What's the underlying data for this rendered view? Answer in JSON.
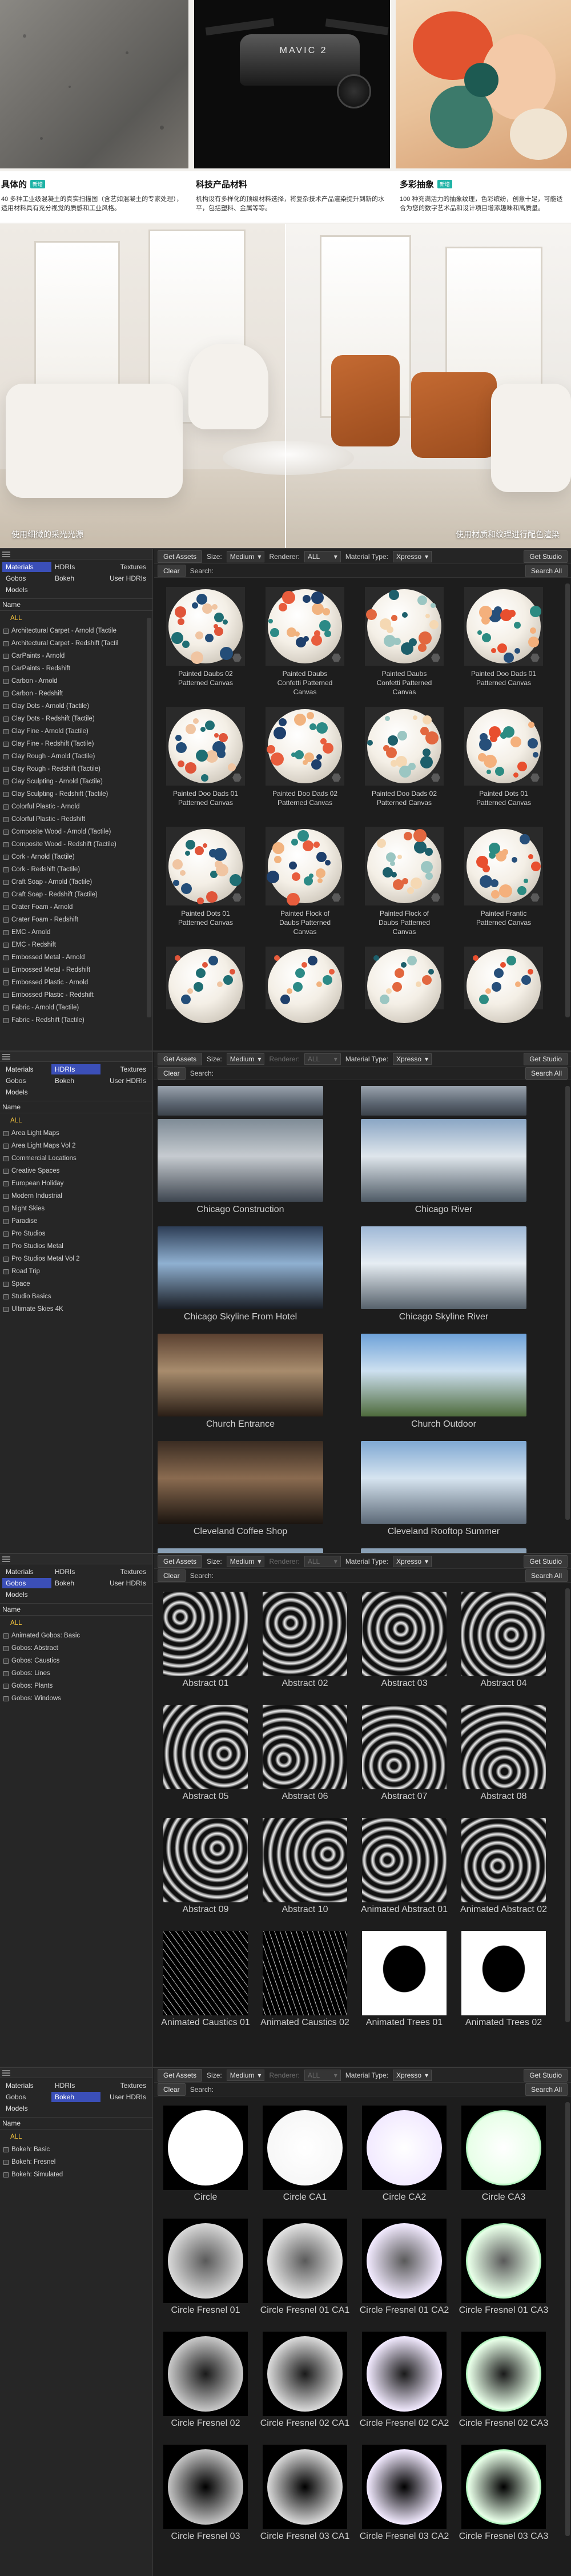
{
  "hero": {
    "thumb2_label": "MAVIC 2",
    "captions": [
      {
        "title": "具体的",
        "tag": "新增",
        "text": "40 多种工业级混凝土的真实扫描图（含艺如混凝土的专家处理），适用材料具有充分视觉的质感和工业风格。"
      },
      {
        "title": "科技产品材料",
        "tag": "",
        "text": "机构设有多样化的顶级材料选择，将复杂技术产品渲染提升到新的水平，包括塑料、金属等等。"
      },
      {
        "title": "多彩抽象",
        "tag": "新增",
        "text": "100 种充满活力的抽象纹理，色彩缤纷，创意十足，可能适合为您的数字艺术品和设计项目增添趣味和高质量。"
      }
    ],
    "room_label_left": "使用细微的采光光源",
    "room_label_right": "使用材质和纹理进行配色渲染"
  },
  "common": {
    "tabs": [
      "Materials",
      "HDRIs",
      "Textures",
      "Gobos",
      "Bokeh",
      "User HDRIs",
      "Models"
    ],
    "name_header": "Name",
    "all_label": "ALL",
    "get_assets": "Get Assets",
    "size_label": "Size:",
    "size_value": "Medium",
    "renderer_label": "Renderer:",
    "renderer_value": "ALL",
    "material_type_label": "Material Type:",
    "material_type_value": "Xpresso",
    "get_studio": "Get Studio",
    "clear": "Clear",
    "search_label": "Search:",
    "search_all": "Search All"
  },
  "materials_panel": {
    "active_tab": "Materials",
    "items": [
      "Architectural Carpet - Arnold (Tactile",
      "Architectural Carpet - Redshift (Tactil",
      "CarPaints - Arnold",
      "CarPaints - Redshift",
      "Carbon - Arnold",
      "Carbon - Redshift",
      "Clay Dots - Arnold (Tactile)",
      "Clay Dots - Redshift (Tactile)",
      "Clay Fine - Arnold (Tactile)",
      "Clay Fine - Redshift (Tactile)",
      "Clay Rough - Arnold (Tactile)",
      "Clay Rough - Redshift (Tactile)",
      "Clay Sculpting - Arnold (Tactile)",
      "Clay Sculpting - Redshift (Tactile)",
      "Colorful Plastic - Arnold",
      "Colorful Plastic - Redshift",
      "Composite Wood - Arnold (Tactile)",
      "Composite Wood - Redshift (Tactile)",
      "Cork - Arnold (Tactile)",
      "Cork - Redshift (Tactile)",
      "Craft Soap - Arnold (Tactile)",
      "Craft Soap - Redshift (Tactile)",
      "Crater Foam - Arnold",
      "Crater Foam - Redshift",
      "EMC - Arnold",
      "EMC - Redshift",
      "Embossed Metal - Arnold",
      "Embossed Metal - Redshift",
      "Embossed Plastic - Arnold",
      "Embossed Plastic - Redshift",
      "Fabric - Arnold (Tactile)",
      "Fabric - Redshift (Tactile)"
    ],
    "cards": [
      [
        "Painted Daubs 02",
        "Patterned Canvas"
      ],
      [
        "Painted Daubs",
        "Confetti Patterned",
        "Canvas"
      ],
      [
        "Painted Daubs",
        "Confetti Patterned",
        "Canvas"
      ],
      [
        "Painted Doo Dads 01",
        "Patterned Canvas"
      ],
      [
        "Painted Doo Dads 01",
        "Patterned Canvas"
      ],
      [
        "Painted Doo Dads 02",
        "Patterned Canvas"
      ],
      [
        "Painted Doo Dads 02",
        "Patterned Canvas"
      ],
      [
        "Painted Dots 01",
        "Patterned Canvas"
      ],
      [
        "Painted Dots 01",
        "Patterned Canvas"
      ],
      [
        "Painted Flock of",
        "Daubs Patterned",
        "Canvas"
      ],
      [
        "Painted Flock of",
        "Daubs Patterned",
        "Canvas"
      ],
      [
        "Painted Frantic",
        "Patterned Canvas"
      ]
    ]
  },
  "hdri_panel": {
    "active_tab": "HDRIs",
    "items": [
      "Area Light Maps",
      "Area Light Maps Vol 2",
      "Commercial Locations",
      "Creative Spaces",
      "European Holiday",
      "Modern Industrial",
      "Night Skies",
      "Paradise",
      "Pro Studios",
      "Pro Studios Metal",
      "Pro Studios Metal Vol 2",
      "Road Trip",
      "Space",
      "Studio Basics",
      "Ultimate Skies 4K"
    ],
    "cards": [
      "Chicago Construction",
      "Chicago River",
      "Chicago Skyline From Hotel",
      "Chicago Skyline River",
      "Church Entrance",
      "Church Outdoor",
      "Cleveland Coffee Shop",
      "Cleveland Rooftop Summer"
    ]
  },
  "gobos_panel": {
    "active_tab": "Gobos",
    "items": [
      "Animated Gobos: Basic",
      "Gobos: Abstract",
      "Gobos: Caustics",
      "Gobos: Lines",
      "Gobos: Plants",
      "Gobos: Windows"
    ],
    "cards": [
      "Abstract 01",
      "Abstract 02",
      "Abstract 03",
      "Abstract 04",
      "Abstract 05",
      "Abstract 06",
      "Abstract 07",
      "Abstract 08",
      "Abstract 09",
      "Abstract 10",
      "Animated Abstract 01",
      "Animated Abstract 02",
      "Animated Caustics 01",
      "Animated Caustics 02",
      "Animated Trees 01",
      "Animated Trees 02"
    ]
  },
  "bokeh_panel": {
    "active_tab": "Bokeh",
    "items": [
      "Bokeh: Basic",
      "Bokeh: Fresnel",
      "Bokeh: Simulated"
    ],
    "cards": [
      "Circle",
      "Circle CA1",
      "Circle CA2",
      "Circle CA3",
      "Circle Fresnel 01",
      "Circle Fresnel 01 CA1",
      "Circle Fresnel 01 CA2",
      "Circle Fresnel 01 CA3",
      "Circle Fresnel 02",
      "Circle Fresnel 02 CA1",
      "Circle Fresnel 02 CA2",
      "Circle Fresnel 02 CA3",
      "Circle Fresnel 03",
      "Circle Fresnel 03 CA1",
      "Circle Fresnel 03 CA2",
      "Circle Fresnel 03 CA3"
    ]
  }
}
